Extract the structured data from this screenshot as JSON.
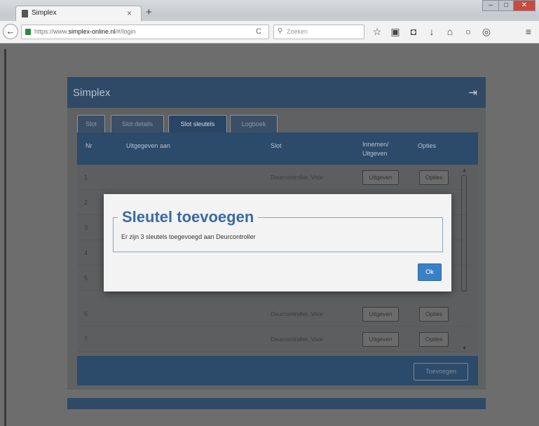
{
  "browser": {
    "tab_title": "Simplex",
    "tab_close": "×",
    "new_tab": "+",
    "url_prefix": "https://www.",
    "url_domain": "simplex-online.nl",
    "url_suffix": "/#/login",
    "search_placeholder": "Zoeken",
    "icons": [
      "back-icon",
      "lock-icon",
      "reload-icon",
      "search-icon",
      "star-icon",
      "reading-list-icon",
      "pocket-icon",
      "download-icon",
      "home-icon",
      "chat-icon",
      "extension-icon",
      "menu-icon"
    ]
  },
  "app": {
    "title": "Simplex",
    "logout_icon": "⇥"
  },
  "tabs": [
    {
      "label": "Slot"
    },
    {
      "label": "Slot details"
    },
    {
      "label": "Slot sleutels"
    },
    {
      "label": "Logboek"
    }
  ],
  "table": {
    "headers": {
      "nr": "Nr",
      "issued_to": "Uitgegeven aan",
      "slot": "Slot",
      "collect_line1": "Innemen/",
      "collect_line2": "Uitgeven",
      "options": "Opties"
    },
    "rows": [
      {
        "nr": "1",
        "slot": "Deurcontroller, Voor",
        "action": "Uitgeven",
        "options": "Opties"
      },
      {
        "nr": "2",
        "slot": "",
        "action": "",
        "options": ""
      },
      {
        "nr": "3",
        "slot": "",
        "action": "",
        "options": ""
      },
      {
        "nr": "4",
        "slot": "",
        "action": "",
        "options": ""
      },
      {
        "nr": "5",
        "slot": "",
        "action": "",
        "options": ""
      },
      {
        "nr": "6",
        "slot": "Deurcontroller, Voor",
        "action": "Uitgeven",
        "options": "Opties"
      },
      {
        "nr": "7",
        "slot": "Deurcontroller, Voor",
        "action": "Uitgeven",
        "options": "Opties"
      }
    ]
  },
  "footer": {
    "add_label": "Toevoegen"
  },
  "modal": {
    "title": "Sleutel toevoegen",
    "message": "Er zijn 3 sleutels toegevoegd aan Deurcontroller",
    "ok_label": "Ok"
  }
}
